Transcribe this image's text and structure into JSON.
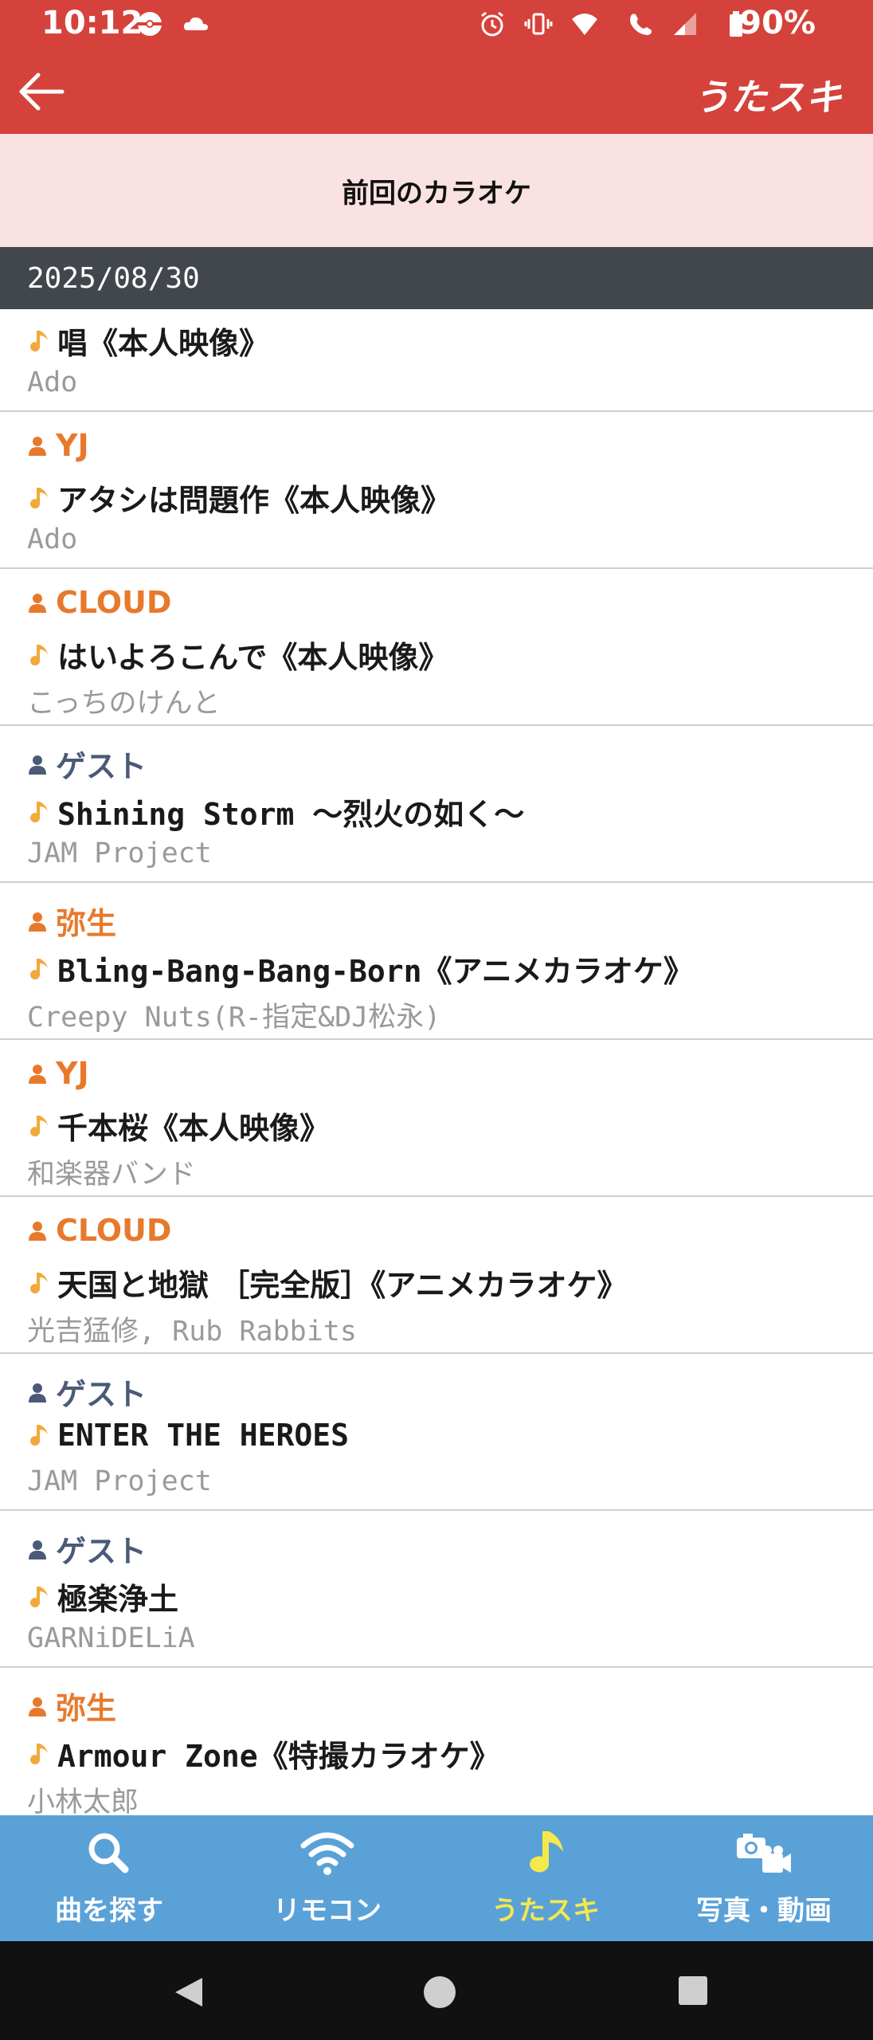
{
  "status_bar": {
    "time": "10:12",
    "battery": "90%"
  },
  "header": {
    "brand": "うたスキ",
    "back_icon": "arrow-left-icon"
  },
  "section_title": "前回のカラオケ",
  "date": "2025/08/30",
  "entries": [
    {
      "user": "",
      "user_type": "member",
      "song": "唱《本人映像》",
      "artist": "Ado"
    },
    {
      "user": "YJ",
      "user_type": "member",
      "song": "アタシは問題作《本人映像》",
      "artist": "Ado"
    },
    {
      "user": "CLOUD",
      "user_type": "member",
      "song": "はいよろこんで《本人映像》",
      "artist": "こっちのけんと"
    },
    {
      "user": "ゲスト",
      "user_type": "guest",
      "song": "Shining Storm ～烈火の如く～",
      "artist": "JAM Project"
    },
    {
      "user": "弥生",
      "user_type": "member",
      "song": "Bling-Bang-Bang-Born《アニメカラオケ》",
      "artist": "Creepy Nuts(R-指定&DJ松永)"
    },
    {
      "user": "YJ",
      "user_type": "member",
      "song": "千本桜《本人映像》",
      "artist": "和楽器バンド"
    },
    {
      "user": "CLOUD",
      "user_type": "member",
      "song": "天国と地獄 ［完全版］《アニメカラオケ》",
      "artist": "光吉猛修, Rub Rabbits"
    },
    {
      "user": "ゲスト",
      "user_type": "guest",
      "song": "ENTER THE HEROES",
      "artist": "JAM Project"
    },
    {
      "user": "ゲスト",
      "user_type": "guest",
      "song": "極楽浄土",
      "artist": "GARNiDELiA"
    },
    {
      "user": "弥生",
      "user_type": "member",
      "song": "Armour Zone《特撮カラオケ》",
      "artist": "小林太郎"
    }
  ],
  "bottom_nav": [
    {
      "label": "曲を探す",
      "icon": "search-icon",
      "active": false
    },
    {
      "label": "リモコン",
      "icon": "wifi-icon",
      "active": false
    },
    {
      "label": "うたスキ",
      "icon": "music-note-icon",
      "active": true
    },
    {
      "label": "写真・動画",
      "icon": "camera-video-icon",
      "active": false
    }
  ],
  "colors": {
    "header": "#d5423b",
    "section_bg": "#f9e2e1",
    "date_bar": "#42474d",
    "member_name": "#e8792c",
    "guest_name": "#4a5a78",
    "note": "#f2a93b",
    "nav_bg": "#5aa1d8",
    "nav_active": "#f4e84c"
  }
}
